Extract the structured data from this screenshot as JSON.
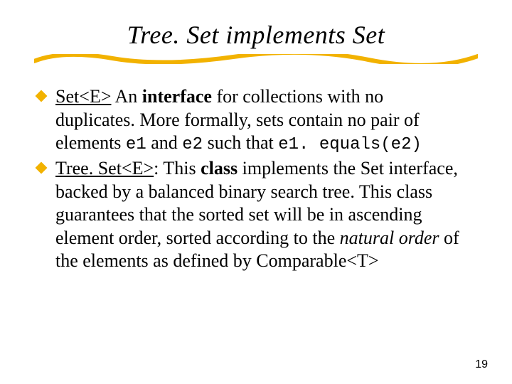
{
  "title": "Tree. Set implements Set",
  "bullets": [
    {
      "link": "Set<E>",
      "lead": " An ",
      "bold": "interface",
      "rest_a": " for collections with no duplicates. More formally, sets contain no pair of elements ",
      "code1": "e1",
      "mid1": " and ",
      "code2": "e2",
      "mid2": " such that ",
      "code3": "e1. equals(e2)"
    },
    {
      "link": "Tree. Set<E>",
      "after_link": ": This ",
      "bold": "class",
      "rest_a": " implements the Set interface, backed by a balanced binary search tree. This class guarantees that the sorted set will be in ascending element order, sorted according to the ",
      "ital": "natural order",
      "rest_b": " of the elements as defined by Comparable<T>"
    }
  ],
  "page_number": "19"
}
